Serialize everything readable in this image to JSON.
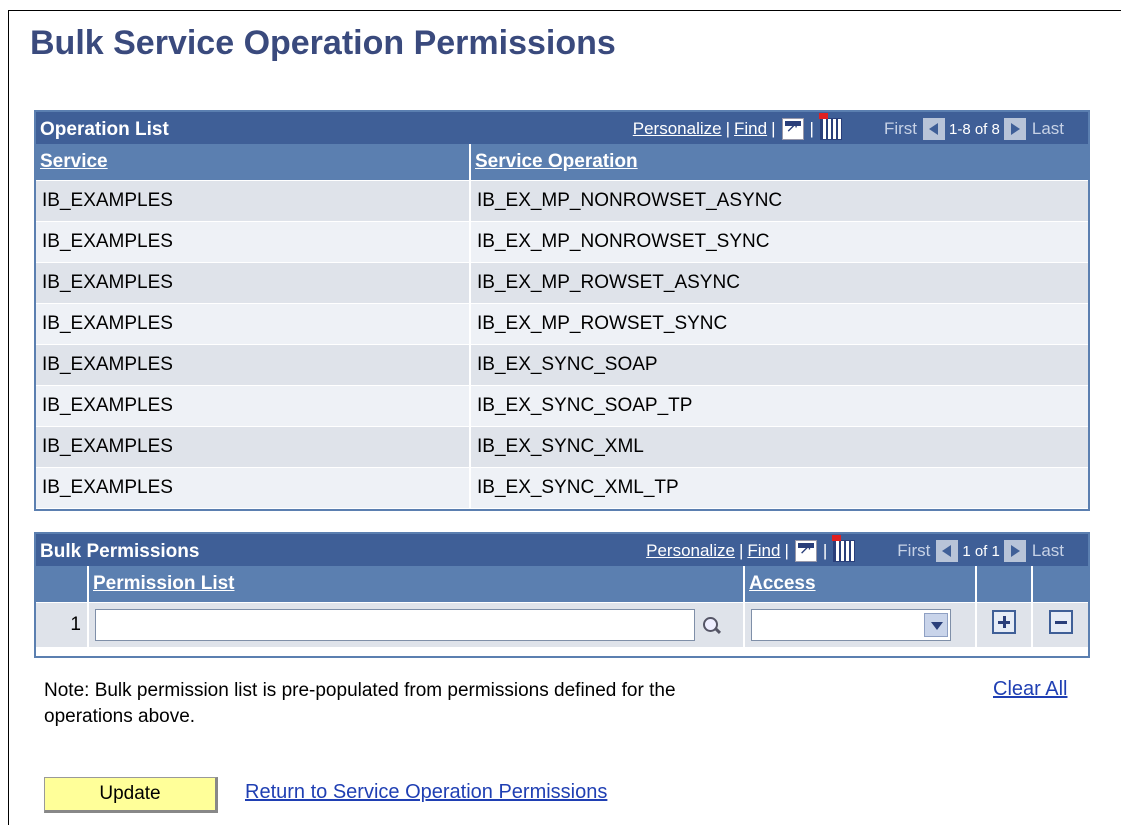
{
  "page": {
    "title": "Bulk Service Operation Permissions"
  },
  "nav_common": {
    "personalize": "Personalize",
    "find": "Find",
    "separator": "|",
    "first": "First",
    "last": "Last"
  },
  "operation_list": {
    "title": "Operation List",
    "range": "1-8 of 8",
    "columns": {
      "service": "Service",
      "operation": "Service Operation"
    },
    "rows": [
      {
        "service": "IB_EXAMPLES",
        "operation": "IB_EX_MP_NONROWSET_ASYNC"
      },
      {
        "service": "IB_EXAMPLES",
        "operation": "IB_EX_MP_NONROWSET_SYNC"
      },
      {
        "service": "IB_EXAMPLES",
        "operation": "IB_EX_MP_ROWSET_ASYNC"
      },
      {
        "service": "IB_EXAMPLES",
        "operation": "IB_EX_MP_ROWSET_SYNC"
      },
      {
        "service": "IB_EXAMPLES",
        "operation": "IB_EX_SYNC_SOAP"
      },
      {
        "service": "IB_EXAMPLES",
        "operation": "IB_EX_SYNC_SOAP_TP"
      },
      {
        "service": "IB_EXAMPLES",
        "operation": "IB_EX_SYNC_XML"
      },
      {
        "service": "IB_EXAMPLES",
        "operation": "IB_EX_SYNC_XML_TP"
      }
    ]
  },
  "bulk_permissions": {
    "title": "Bulk Permissions",
    "range": "1 of 1",
    "columns": {
      "permission_list": "Permission List",
      "access": "Access"
    },
    "row": {
      "number": "1",
      "permission_list_value": "",
      "access_value": ""
    }
  },
  "note": "Note: Bulk permission list is pre-populated from permissions defined for the operations above.",
  "clear_all": "Clear All",
  "update_button": "Update",
  "return_link": "Return to Service Operation Permissions",
  "colors": {
    "title": "#3a4a7d",
    "grid_bar": "#3f5f97",
    "header": "#5b7fb0",
    "row_odd": "#dfe3ea",
    "row_even": "#eef1f6",
    "link": "#1f3fb3",
    "button": "#ffff99"
  }
}
